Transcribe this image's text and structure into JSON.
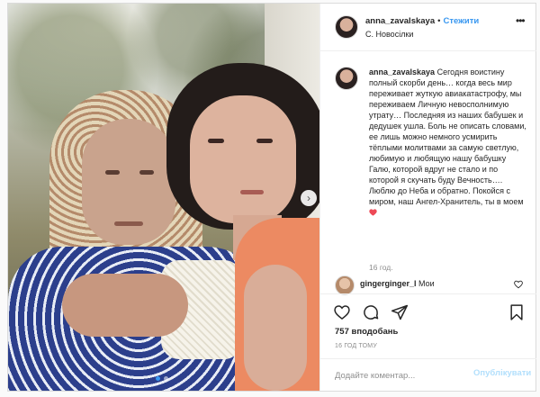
{
  "header": {
    "username": "anna_zavalskaya",
    "separator": "•",
    "follow_label": "Стежити",
    "location": "С. Новосілки"
  },
  "caption": {
    "username": "anna_zavalskaya",
    "text": "Сегодня воистину полный скорби день… когда весь мир переживает жуткую авиакатастрофу, мы переживаем Личную невосполнимую утрату… Последняя из наших бабушек и дедушек ушла. Боль не описать словами, ее лишь можно немного усмирить тёплыми молитвами за самую светлую, любимую и любящую нашу бабушку Галю, которой вдруг не стало и по которой я скучать буду Вечность…. Люблю до Неба и обратно. Покойся с миром, наш Ангел-Хранитель, ты в моем",
    "emoji": "heart",
    "time_ago": "16 год."
  },
  "comment": {
    "username": "gingerginger_l",
    "text": "Мои"
  },
  "likes": "757 вподобань",
  "date": "16 ГОД ТОМУ",
  "comment_box": {
    "placeholder": "Додайте коментар...",
    "post_label": "Опублікувати"
  },
  "carousel": {
    "total": 2,
    "active": 1
  },
  "icons": [
    "more-icon",
    "heart-icon",
    "comment-icon",
    "share-icon",
    "bookmark-icon",
    "next-arrow-icon"
  ],
  "colors": {
    "link": "#3897f0",
    "post_disabled": "#b2dffc",
    "heart": "#ed4956"
  }
}
